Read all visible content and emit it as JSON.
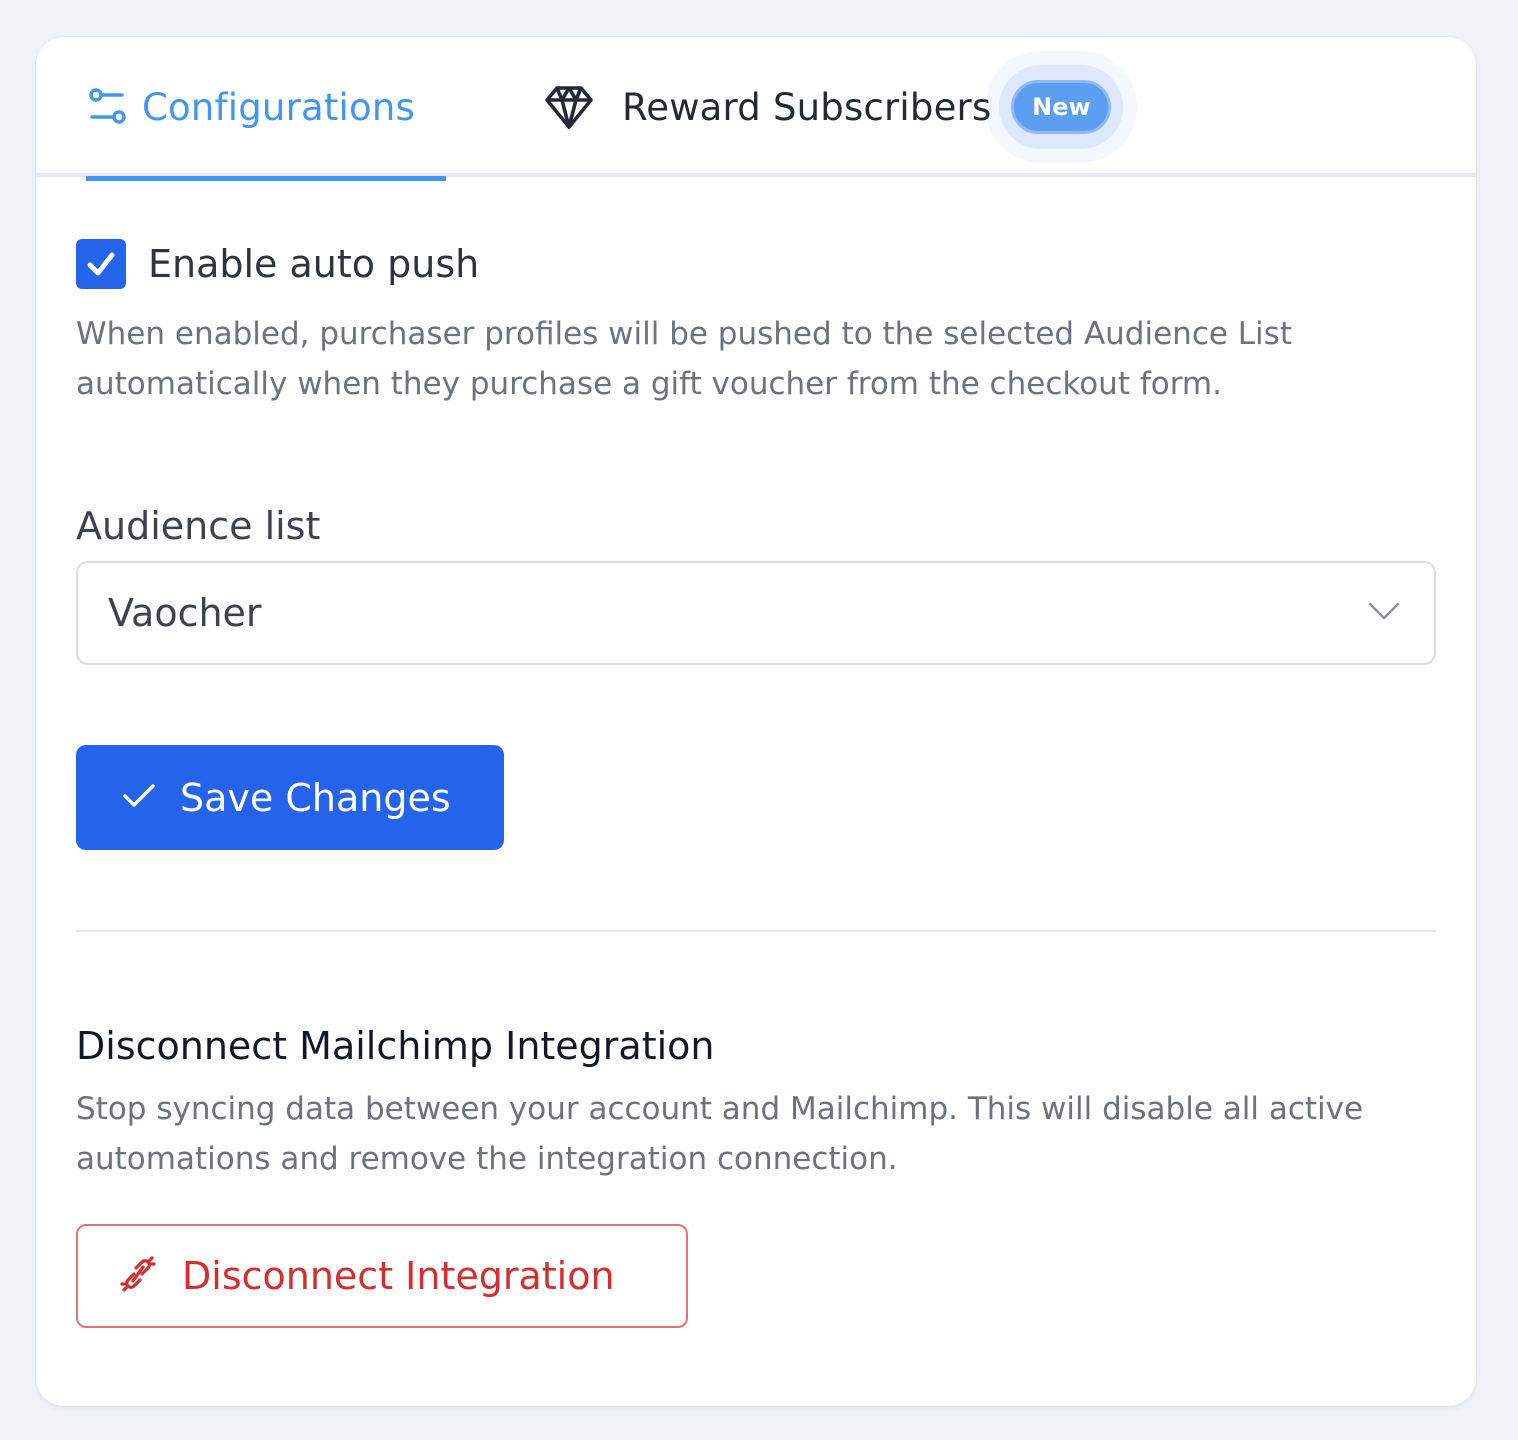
{
  "tabs": {
    "configurations": {
      "label": "Configurations",
      "icon": "sliders-icon",
      "active": true
    },
    "reward_subscribers": {
      "label": "Reward Subscribers",
      "icon": "diamond-icon",
      "badge": "New"
    }
  },
  "auto_push": {
    "label": "Enable auto push",
    "checked": true,
    "help": "When enabled, purchaser profiles will be pushed to the selected Audience List automatically when they purchase a gift voucher from the checkout form."
  },
  "audience_list": {
    "label": "Audience list",
    "selected": "Vaocher",
    "icon": "chevron-down-icon"
  },
  "save_button": {
    "label": "Save Changes",
    "icon": "check-icon"
  },
  "disconnect_section": {
    "title": "Disconnect Mailchimp Integration",
    "description": "Stop syncing data between your account and Mailchimp. This will disable all active automations and remove the integration connection.",
    "button_label": "Disconnect Integration",
    "button_icon": "unlink-icon"
  },
  "colors": {
    "primary": "#2563eb",
    "tab_active": "#4196f0",
    "danger": "#d32f2f",
    "badge": "#5c9ff0"
  }
}
